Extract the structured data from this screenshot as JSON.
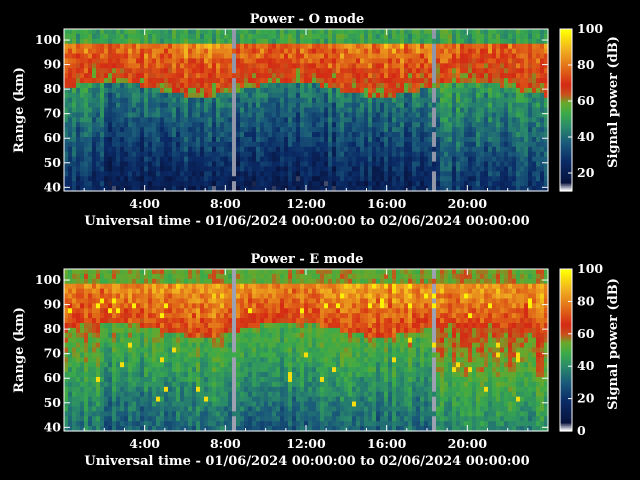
{
  "colors": {
    "background": "#000000",
    "text": "#ffffff",
    "colormap": [
      "#ffffff",
      "#08123c",
      "#0a2a66",
      "#1a5a7a",
      "#2a8a6a",
      "#3aaa4a",
      "#6aa82a",
      "#c8501a",
      "#d42814",
      "#e06818",
      "#f0b020",
      "#ffff00"
    ]
  },
  "chart_data": [
    {
      "type": "heatmap",
      "title": "Power - O mode",
      "xlabel": "Universal time - 01/06/2024 00:00:00 to 02/06/2024 00:00:00",
      "ylabel": "Range (km)",
      "x_unit": "hours UT",
      "xlim": [
        0,
        24
      ],
      "ylim": [
        38.5,
        104.5
      ],
      "x_ticks": [
        4,
        8,
        12,
        16,
        20
      ],
      "x_tick_labels": [
        "4:00",
        "8:00",
        "12:00",
        "16:00",
        "20:00"
      ],
      "y_ticks": [
        40,
        50,
        60,
        70,
        80,
        90,
        100
      ],
      "y_tick_labels": [
        "40",
        "50",
        "60",
        "70",
        "80",
        "90",
        "100"
      ],
      "colorbar": {
        "label": "Signal power (dB)",
        "range": [
          10,
          100
        ],
        "ticks": [
          20,
          40,
          60,
          80,
          100
        ],
        "tick_labels": [
          "20",
          "40",
          "60",
          "80",
          "100"
        ]
      },
      "structure": {
        "gap_times_h": [
          8.5,
          18.3
        ],
        "upper_layer_db": 65,
        "transition_km": 80,
        "lower_layer_db": 25,
        "top_band_db": 48
      }
    },
    {
      "type": "heatmap",
      "title": "Power - E mode",
      "xlabel": "Universal time - 01/06/2024 00:00:00 to 02/06/2024 00:00:00",
      "ylabel": "Range (km)",
      "x_unit": "hours UT",
      "xlim": [
        0,
        24
      ],
      "ylim": [
        38.5,
        104.5
      ],
      "x_ticks": [
        4,
        8,
        12,
        16,
        20
      ],
      "x_tick_labels": [
        "4:00",
        "8:00",
        "12:00",
        "16:00",
        "20:00"
      ],
      "y_ticks": [
        40,
        50,
        60,
        70,
        80,
        90,
        100
      ],
      "y_tick_labels": [
        "40",
        "50",
        "60",
        "70",
        "80",
        "90",
        "100"
      ],
      "colorbar": {
        "label": "Signal power (dB)",
        "range": [
          0,
          100
        ],
        "ticks": [
          0,
          20,
          40,
          60,
          80,
          100
        ],
        "tick_labels": [
          "0",
          "20",
          "40",
          "60",
          "80",
          "100"
        ]
      },
      "structure": {
        "gap_times_h": [
          8.5,
          18.3
        ],
        "upper_layer_db": 68,
        "transition_km": 80,
        "lower_layer_db": 35,
        "top_band_db": 50
      }
    }
  ]
}
